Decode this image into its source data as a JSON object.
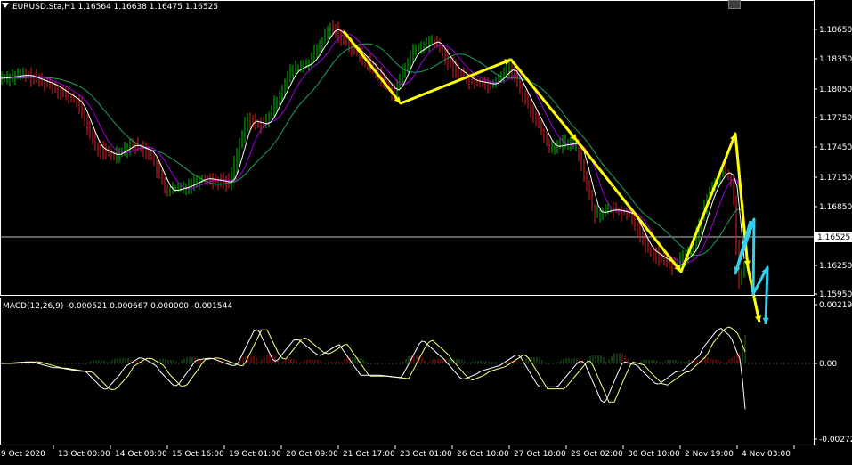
{
  "header": {
    "symbol_line": "EURUSD.Sta,H1  1.16564 1.16638 1.16475 1.16525",
    "macd_line": "MACD(12,26,9) -0.000521 0.000667 0.000000 -0.001544"
  },
  "price_axis": {
    "labels": [
      "1.18650",
      "1.18350",
      "1.18050",
      "1.17750",
      "1.17450",
      "1.17150",
      "1.16850",
      "1.16525",
      "1.16250",
      "1.15950"
    ],
    "current_price": "1.16525"
  },
  "macd_axis": {
    "labels": [
      "0.002199",
      "0.00",
      "-0.002724"
    ]
  },
  "time_axis": {
    "labels": [
      "9 Oct 2020",
      "13 Oct 00:00",
      "14 Oct 08:00",
      "15 Oct 16:00",
      "19 Oct 01:00",
      "20 Oct 09:00",
      "21 Oct 17:00",
      "23 Oct 01:00",
      "26 Oct 10:00",
      "27 Oct 18:00",
      "29 Oct 02:00",
      "30 Oct 10:00",
      "2 Nov 19:00",
      "4 Nov 03:00"
    ]
  },
  "colors": {
    "background": "#000000",
    "bull": "#00c000",
    "bear": "#e02020",
    "ma_fast": "#ffffff",
    "ma_mid": "#a000e0",
    "ma_slow": "#20a060",
    "arrow_yellow": "#ffff00",
    "arrow_cyan": "#30d0f0",
    "hist_pos": "#b01010",
    "hist_neg": "#207020",
    "macd_line": "#ffffff",
    "signal_line": "#ffff80"
  },
  "chart_data": [
    {
      "type": "line",
      "title": "EURUSD.Sta,H1",
      "y_range": [
        1.1595,
        1.188
      ],
      "x_categories": [
        "9 Oct 2020",
        "13 Oct 00:00",
        "14 Oct 08:00",
        "15 Oct 16:00",
        "19 Oct 01:00",
        "20 Oct 09:00",
        "21 Oct 17:00",
        "23 Oct 01:00",
        "26 Oct 10:00",
        "27 Oct 18:00",
        "29 Oct 02:00",
        "30 Oct 10:00",
        "2 Nov 19:00",
        "4 Nov 03:00"
      ],
      "series": [
        {
          "name": "",
          "values": [
            1.1825,
            1.18,
            1.1725,
            1.1718,
            1.1705,
            1.183,
            1.186,
            1.18,
            1.184,
            1.1815,
            1.169,
            1.164,
            1.168,
            1.172
          ]
        }
      ],
      "annotations": {
        "yellow_path": [
          [
            1.1864,
            0
          ],
          [
            1.179,
            1
          ],
          [
            1.1833,
            2
          ],
          [
            1.1745,
            3
          ],
          [
            1.162,
            4
          ],
          [
            1.175,
            5
          ],
          [
            1.16,
            6
          ],
          [
            1.1585,
            7
          ]
        ],
        "cyan_path": [
          [
            1.1665,
            0
          ],
          [
            1.1625,
            1
          ],
          [
            1.1665,
            2
          ],
          [
            1.1595,
            3
          ],
          [
            1.163,
            4
          ],
          [
            1.158,
            5
          ]
        ]
      }
    },
    {
      "type": "bar",
      "title": "MACD(12,26,9)",
      "y_range": [
        -0.002724,
        0.002199
      ],
      "values": [
        0.0008,
        0.0006,
        -0.0004,
        -0.0012,
        -0.0008,
        0.0014,
        0.001,
        0.0004,
        0.0006,
        -0.0006,
        -0.0014,
        -0.0008,
        0.0012,
        0.0004,
        -0.0014
      ]
    }
  ]
}
